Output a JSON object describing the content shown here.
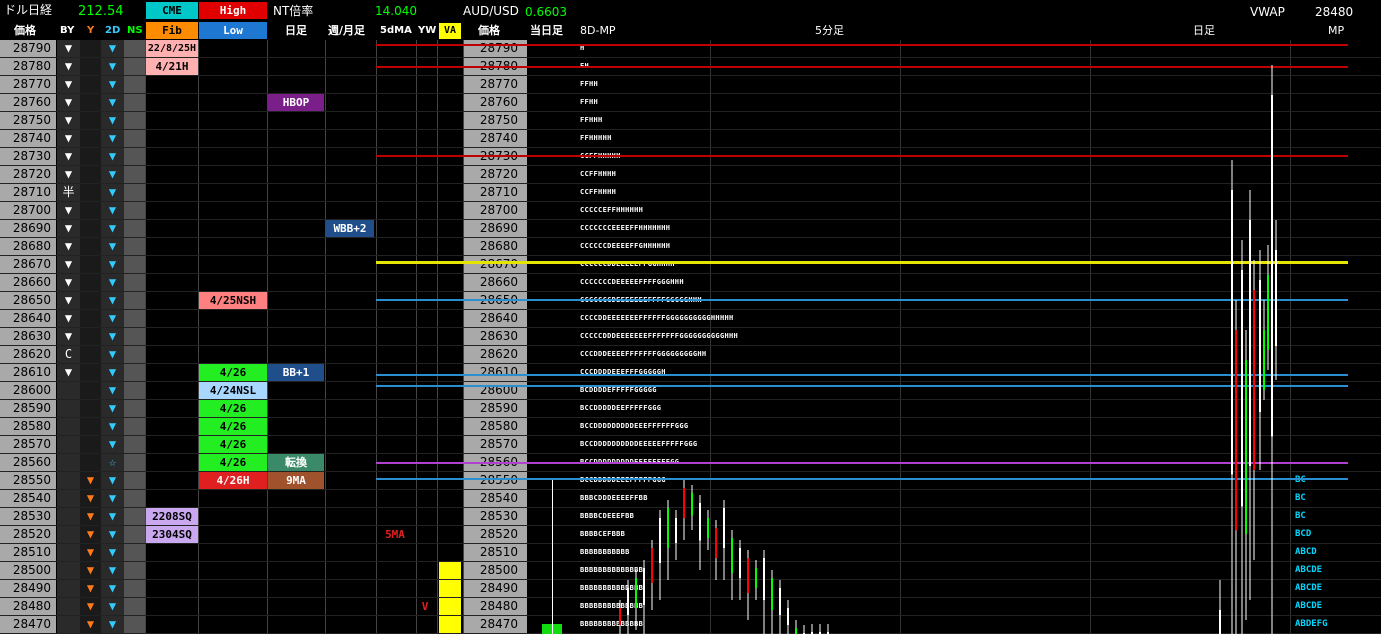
{
  "header": {
    "instrument": "ドル日経",
    "instrument_value": "212.54",
    "cme": "CME",
    "high": "High",
    "fib": "Fib",
    "low": "Low",
    "nt_label": "NT倍率",
    "nt_value": "14.040",
    "aud_label": "AUD/USD",
    "aud_value": "0.6603",
    "vwap_label": "VWAP",
    "vwap_value": "28480"
  },
  "columns": {
    "price": "価格",
    "by": "BY",
    "y": "Y",
    "d2": "2D",
    "ns": "NS",
    "daily": "日足",
    "weekly": "週/月足",
    "ma5": "5dMA",
    "yw": "YW",
    "va": "VA",
    "price2": "価格",
    "today": "当日足",
    "mp8d": "8D-MP",
    "min5": "5分足",
    "daily2": "日足",
    "mp": "MP"
  },
  "rows": [
    {
      "p": "28790",
      "by": "▼",
      "d2": "▼",
      "tpo": "H"
    },
    {
      "p": "28780",
      "by": "▼",
      "d2": "▼",
      "tpo": "FH"
    },
    {
      "p": "28770",
      "by": "▼",
      "d2": "▼",
      "tpo": "FFHH"
    },
    {
      "p": "28760",
      "by": "▼",
      "d2": "▼",
      "tpo": "FFHH"
    },
    {
      "p": "28750",
      "by": "▼",
      "d2": "▼",
      "tpo": "FFHHH"
    },
    {
      "p": "28740",
      "by": "▼",
      "d2": "▼",
      "tpo": "FFHHHHH"
    },
    {
      "p": "28730",
      "by": "▼",
      "d2": "▼",
      "tpo": "CCFFHHHHH"
    },
    {
      "p": "28720",
      "by": "▼",
      "d2": "▼",
      "tpo": "CCFFHHHH"
    },
    {
      "p": "28710",
      "by": "半",
      "d2": "▼",
      "tpo": "CCFFHHHH"
    },
    {
      "p": "28700",
      "by": "▼",
      "d2": "▼",
      "tpo": "CCCCCEFFHHHHHH"
    },
    {
      "p": "28690",
      "by": "▼",
      "d2": "▼",
      "tpo": "CCCCCCCEEEEFFHHHHHHH"
    },
    {
      "p": "28680",
      "by": "▼",
      "d2": "▼",
      "tpo": "CCCCCCDEEEEFFGHHHHHH"
    },
    {
      "p": "28670",
      "by": "▼",
      "d2": "▼",
      "tpo": "CCCCCCDDEEEEEFFGGHHHH"
    },
    {
      "p": "28660",
      "by": "▼",
      "d2": "▼",
      "tpo": "CCCCCCCDEEEEEFFFFGGGHHH"
    },
    {
      "p": "28650",
      "by": "▼",
      "d2": "▼",
      "tpo": "CCCCCCCDEEEEEEEFFFFGGGGGHHH"
    },
    {
      "p": "28640",
      "by": "▼",
      "d2": "▼",
      "tpo": "CCCCDDEEEEEEEFFFFFFGGGGGGGGGGHHHHH"
    },
    {
      "p": "28630",
      "by": "▼",
      "d2": "▼",
      "tpo": "CCCCCDDDEEEEEEEFFFFFFFGGGGGGGGGGHHH"
    },
    {
      "p": "28620",
      "by": "C",
      "d2": "▼",
      "tpo": "CCCDDDEEEEFFFFFFFGGGGGGGGGHH"
    },
    {
      "p": "28610",
      "by": "▼",
      "d2": "▼",
      "tpo": "CCCDDDDEEEFFFGGGGGH"
    },
    {
      "p": "28600",
      "by": "",
      "d2": "▼",
      "tpo": "BCDDDDEFFFFFGGGGG"
    },
    {
      "p": "28590",
      "by": "",
      "d2": "▼",
      "tpo": "BCCDDDDDEEFFFFFGGG"
    },
    {
      "p": "28580",
      "by": "",
      "d2": "▼",
      "tpo": "BCCDDDDDDDDDEEEFFFFFFGGG"
    },
    {
      "p": "28570",
      "by": "",
      "d2": "▼",
      "tpo": "BCCDDDDDDDDDDEEEEEFFFFFGGG"
    },
    {
      "p": "28560",
      "by": "",
      "y": "",
      "d2": "☆",
      "tpo": "BCCDDDDDDDDDEEEFFFFFGG"
    },
    {
      "p": "28550",
      "by": "",
      "y": "▼",
      "d2": "▼",
      "tpo": "BCCDDDDDEEEFFFFFGGG",
      "ml": "BC"
    },
    {
      "p": "28540",
      "by": "",
      "y": "▼",
      "d2": "▼",
      "tpo": "BBBCDDDEEEEFFBB",
      "ml": "BC"
    },
    {
      "p": "28530",
      "by": "",
      "y": "▼",
      "d2": "▼",
      "tpo": "BBBBCDEEEFBB",
      "ml": "BC"
    },
    {
      "p": "28520",
      "by": "",
      "y": "▼",
      "d2": "▼",
      "tpo": "BBBBCEFBBB",
      "ml": "BCD"
    },
    {
      "p": "28510",
      "by": "",
      "y": "▼",
      "d2": "▼",
      "tpo": "BBBBBBBBBBB",
      "ml": "ABCD"
    },
    {
      "p": "28500",
      "by": "",
      "y": "▼",
      "d2": "▼",
      "tpo": "BBBBBBBBBBBBBB",
      "ml": "ABCDE"
    },
    {
      "p": "28490",
      "by": "",
      "y": "▼",
      "d2": "▼",
      "tpo": "BBBBBBBBBBBBBB",
      "ml": "ABCDE"
    },
    {
      "p": "28480",
      "by": "",
      "y": "▼",
      "d2": "▼",
      "tpo": "BBBBBBBBBBBBBB",
      "ml": "ABCDE"
    },
    {
      "p": "28470",
      "by": "",
      "y": "▼",
      "d2": "▼",
      "tpo": "BBBBBBBBBBBBBB",
      "ml": "ABDEFG"
    }
  ],
  "labels": {
    "fib1": "22/8/25H",
    "fib2": "4/21H",
    "fib3": "2208SQ",
    "fib4": "2304SQ",
    "hl1": "4/25NSH",
    "hl2": "4/26",
    "hl3": "4/24NSL",
    "hl4": "4/26",
    "hl5": "4/26",
    "hl6": "4/26",
    "hl7": "4/26",
    "hl8": "4/26H",
    "d1": "HBOP",
    "d2": "BB+1",
    "d3": "転換",
    "d4": "9MA",
    "w1": "WBB+2",
    "ma5": "5MA",
    "yw": "V"
  },
  "colors": {
    "price_bg": "#a9a9a9",
    "cme": "#00c8c8",
    "high": "#e00000",
    "fib": "#ff8c00",
    "low": "#1e78d2",
    "by_arrow": "#ffffff",
    "y_arrow": "#ff7a1a",
    "d2_arrow": "#33ccff",
    "red_line": "#c00000",
    "yellow_line": "#e5e500",
    "blue_line": "#2a8fd0",
    "purple_line": "#b040d0",
    "va": "#ffff00"
  }
}
